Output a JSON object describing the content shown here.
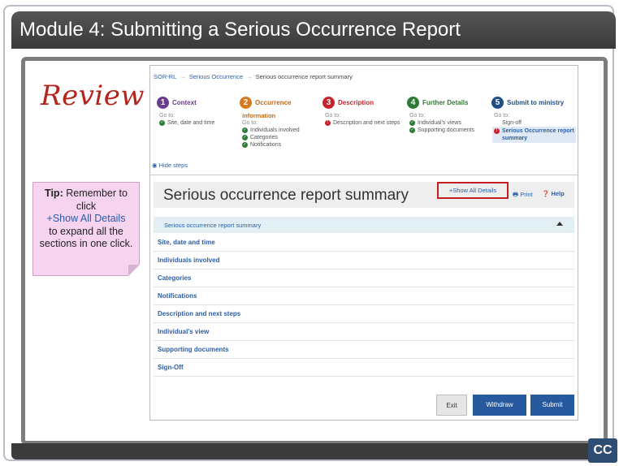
{
  "slide": {
    "title": "Module 4:  Submitting a Serious Occurrence Report",
    "review_heading": "Review",
    "cc_label": "CC"
  },
  "tip": {
    "label": "Tip:",
    "text_1": "Remember to click",
    "link_text": "+Show All Details",
    "text_2": "to expand all the sections in one click."
  },
  "app": {
    "breadcrumb": [
      "SOR-RL",
      "Serious Occurrence",
      "Serious occurrence report summary"
    ],
    "breadcrumb_sep": "→",
    "steps": [
      {
        "num": "1",
        "title": "Context",
        "color": "#6a3b8f",
        "goto": "Go to:",
        "items": [
          {
            "text": "Site, date and time",
            "status": "ok"
          }
        ]
      },
      {
        "num": "2",
        "title": "Occurrence",
        "subtitle": "information",
        "color": "#d77a1c",
        "goto": "Go to:",
        "items": [
          {
            "text": "Individuals involved",
            "status": "ok"
          },
          {
            "text": "Categories",
            "status": "ok"
          },
          {
            "text": "Notifications",
            "status": "ok"
          }
        ]
      },
      {
        "num": "3",
        "title": "Description",
        "color": "#c6242d",
        "goto": "Go to:",
        "items": [
          {
            "text": "Description and next steps",
            "status": "err"
          }
        ]
      },
      {
        "num": "4",
        "title": "Further Details",
        "color": "#2f7a35",
        "goto": "Go to:",
        "items": [
          {
            "text": "Individual's views",
            "status": "ok"
          },
          {
            "text": "Supporting documents",
            "status": "ok"
          }
        ]
      },
      {
        "num": "5",
        "title": "Submit to ministry",
        "color": "#1f4d85",
        "goto": "Go to:",
        "items": [
          {
            "text": "Sign-off",
            "status": "none"
          },
          {
            "text": "Serious Occurrence report summary",
            "status": "err"
          }
        ]
      }
    ],
    "hide_steps": "Hide steps",
    "summary_title": "Serious occurrence report summary",
    "show_all": "+Show All Details",
    "print": "Print",
    "help": "Help",
    "accordion_label": "Serious occurrence report summary",
    "sections": [
      "Site, date and time",
      "Individuals involved",
      "Categories",
      "Notifications",
      "Description and next steps",
      "Individual's view",
      "Supporting documents",
      "Sign-Off"
    ],
    "buttons": {
      "exit": "Exit",
      "withdraw": "Withdraw",
      "submit": "Submit"
    }
  }
}
